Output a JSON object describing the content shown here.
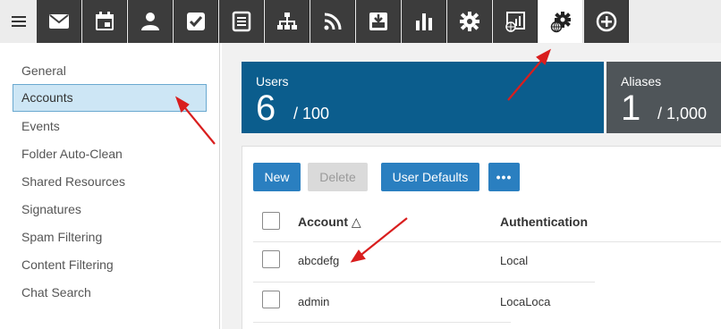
{
  "toolbar": {
    "menu_icon": "hamburger-icon",
    "tools": [
      {
        "icon": "mail-icon"
      },
      {
        "icon": "calendar-icon"
      },
      {
        "icon": "user-icon"
      },
      {
        "icon": "checkbox-task-icon"
      },
      {
        "icon": "notes-icon"
      },
      {
        "icon": "sitemap-icon"
      },
      {
        "icon": "rss-icon"
      },
      {
        "icon": "archive-download-icon"
      },
      {
        "icon": "bar-chart-icon"
      },
      {
        "icon": "gear-icon"
      },
      {
        "icon": "domain-reports-icon"
      },
      {
        "icon": "domain-settings-gear-globe-icon",
        "active": true
      },
      {
        "icon": "add-circle-icon"
      }
    ]
  },
  "sidebar": {
    "items": [
      {
        "label": "General"
      },
      {
        "label": "Accounts",
        "active": true
      },
      {
        "label": "Events"
      },
      {
        "label": "Folder Auto-Clean"
      },
      {
        "label": "Shared Resources"
      },
      {
        "label": "Signatures"
      },
      {
        "label": "Spam Filtering"
      },
      {
        "label": "Content Filtering"
      },
      {
        "label": "Chat Search"
      }
    ]
  },
  "stats": {
    "users": {
      "label": "Users",
      "count": "6",
      "limit": "/ 100"
    },
    "aliases": {
      "label": "Aliases",
      "count": "1",
      "limit": "/ 1,000"
    }
  },
  "actions": {
    "new": "New",
    "delete": "Delete",
    "user_defaults": "User Defaults",
    "more": "•••"
  },
  "table": {
    "columns": {
      "account": "Account △",
      "authentication": "Authentication"
    },
    "rows": [
      {
        "account": "abcdefg",
        "authentication": "Local"
      },
      {
        "account": "admin",
        "authentication": "LocaLoca"
      }
    ]
  },
  "colors": {
    "toolbar_bg": "#3c3c3c",
    "primary": "#2a7fc0",
    "users_tile": "#0b5d8d",
    "aliases_tile": "#4f5559",
    "active_nav": "#cde6f5",
    "annotation_arrow": "#d91e1e"
  }
}
